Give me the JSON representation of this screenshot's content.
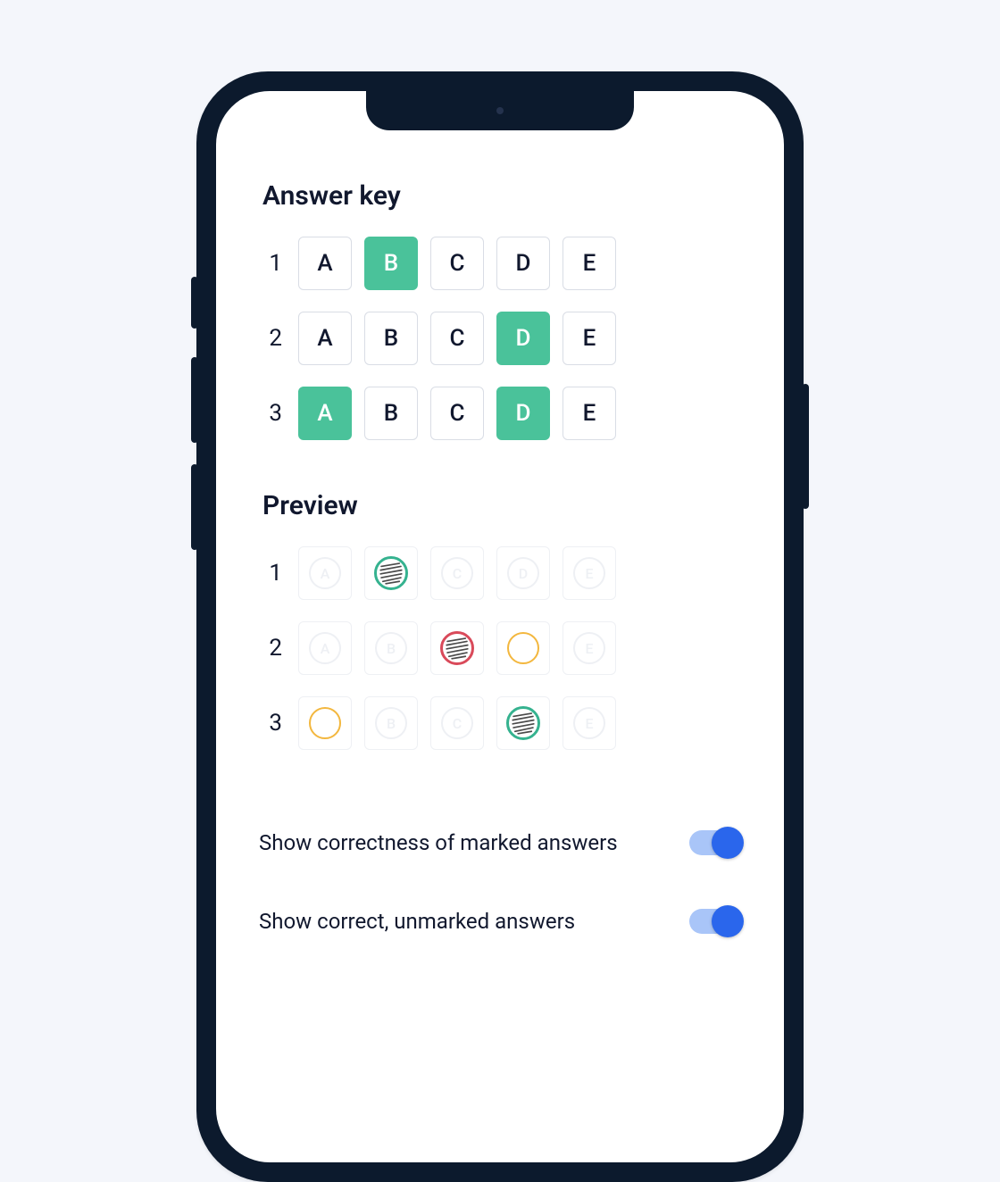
{
  "colors": {
    "accent_green": "#4ac29a",
    "ring_green": "#35b28f",
    "ring_red": "#d94a5a",
    "ring_yellow": "#f3b73e",
    "toggle_track": "#a9c5f8",
    "toggle_knob": "#2a66ec"
  },
  "answer_key": {
    "title": "Answer key",
    "options": [
      "A",
      "B",
      "C",
      "D",
      "E"
    ],
    "rows": [
      {
        "num": "1",
        "selected": [
          "B"
        ]
      },
      {
        "num": "2",
        "selected": [
          "D"
        ]
      },
      {
        "num": "3",
        "selected": [
          "A",
          "D"
        ]
      }
    ]
  },
  "preview": {
    "title": "Preview",
    "options": [
      "A",
      "B",
      "C",
      "D",
      "E"
    ],
    "rows": [
      {
        "num": "1",
        "cells": [
          {
            "state": "ghost"
          },
          {
            "state": "filled",
            "ring": "green"
          },
          {
            "state": "ghost"
          },
          {
            "state": "ghost"
          },
          {
            "state": "ghost"
          }
        ]
      },
      {
        "num": "2",
        "cells": [
          {
            "state": "ghost"
          },
          {
            "state": "ghost"
          },
          {
            "state": "filled",
            "ring": "red"
          },
          {
            "state": "empty-ring",
            "ring": "yellow"
          },
          {
            "state": "ghost"
          }
        ]
      },
      {
        "num": "3",
        "cells": [
          {
            "state": "empty-ring",
            "ring": "yellow"
          },
          {
            "state": "ghost"
          },
          {
            "state": "ghost"
          },
          {
            "state": "filled",
            "ring": "green"
          },
          {
            "state": "ghost"
          }
        ]
      }
    ]
  },
  "settings": [
    {
      "label": "Show correctness of marked answers",
      "on": true
    },
    {
      "label": "Show correct, unmarked answers",
      "on": true
    }
  ]
}
